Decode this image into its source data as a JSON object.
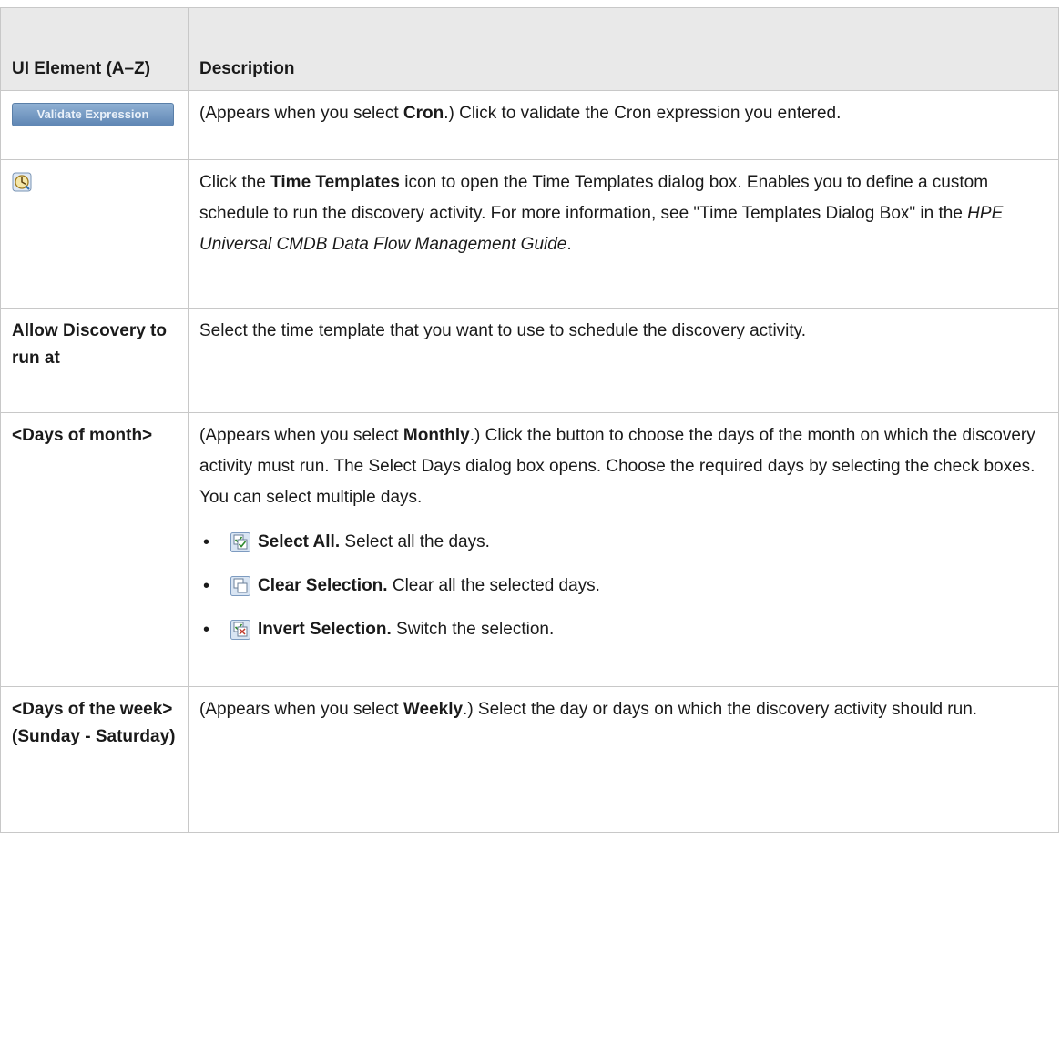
{
  "table": {
    "header_col1": "UI Element (A–Z)",
    "header_col2": "Description"
  },
  "rows": {
    "validate": {
      "button_label": "Validate Expression",
      "d1": "(Appears when you select ",
      "d2": "Cron",
      "d3": ".) Click to validate the Cron expression you entered."
    },
    "time_templates": {
      "icon": "clock-icon",
      "d1": "Click the ",
      "d2": "Time Templates",
      "d3": " icon to open the Time Templates dialog box. Enables you to define a custom schedule to run the discovery activity. For more information, see \"Time Templates Dialog Box\" in the ",
      "d4": "HPE Universal CMDB Data Flow Management Guide",
      "d5": "."
    },
    "allow_discovery": {
      "element": "Allow Discovery to run at",
      "desc": "Select the time template that you want to use to schedule the discovery activity."
    },
    "days_of_month": {
      "element": "<Days of month>",
      "d1": "(Appears when you select ",
      "d2": "Monthly",
      "d3": ".) Click the button to choose the days of the month on which the discovery activity must run. The Select Days dialog box opens. Choose the required days by selecting the check boxes. You can select multiple days.",
      "options": [
        {
          "icon": "select-all-icon",
          "label": "Select All.",
          "text": " Select all the days."
        },
        {
          "icon": "clear-selection-icon",
          "label": "Clear Selection.",
          "text": " Clear all the selected days."
        },
        {
          "icon": "invert-selection-icon",
          "label": "Invert Selection.",
          "text": " Switch the selection."
        }
      ]
    },
    "days_of_week": {
      "element": "<Days of the week> (Sunday - Saturday)",
      "d1": "(Appears when you select ",
      "d2": "Weekly",
      "d3": ".) Select the day or days on which the discovery activity should run."
    }
  }
}
